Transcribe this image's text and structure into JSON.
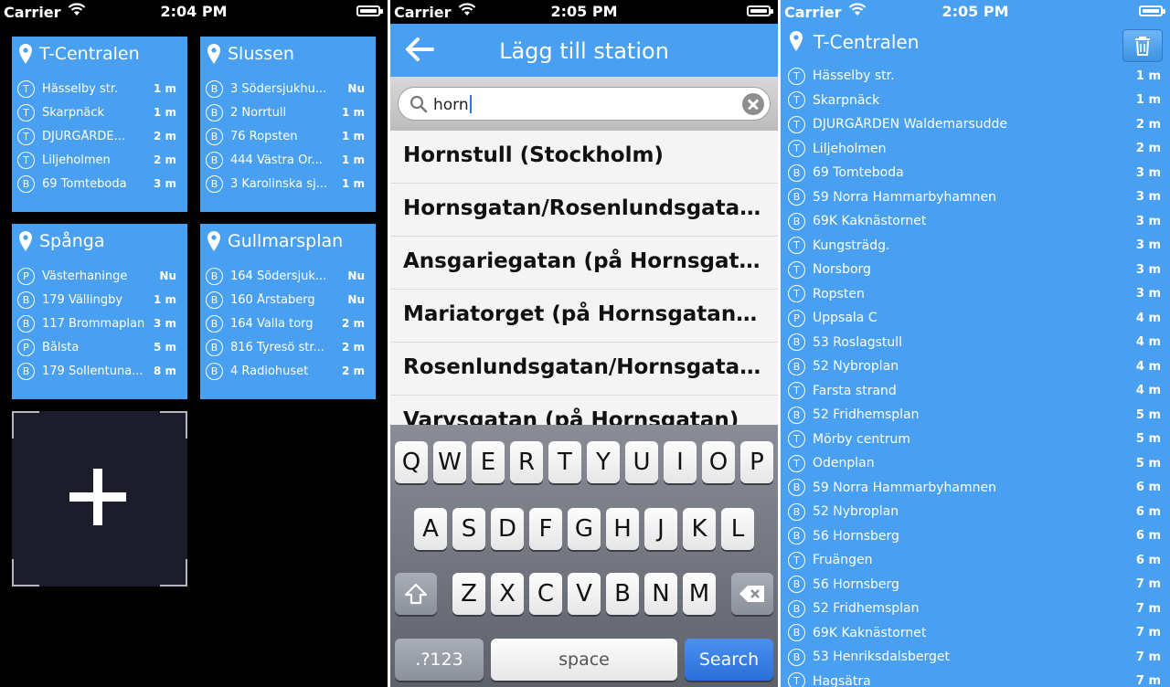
{
  "screens": [
    {
      "status": {
        "carrier": "Carrier",
        "time": "2:04 PM"
      },
      "tiles": [
        {
          "title": "T-Centralen",
          "rows": [
            {
              "badge": "T",
              "name": "Hässelby str.",
              "time": "1 m"
            },
            {
              "badge": "T",
              "name": "Skarpnäck",
              "time": "1 m"
            },
            {
              "badge": "T",
              "name": "DJURGÅRDE...",
              "time": "2 m"
            },
            {
              "badge": "T",
              "name": "Liljeholmen",
              "time": "2 m"
            },
            {
              "badge": "B",
              "name": "69 Tomteboda",
              "time": "3 m"
            }
          ]
        },
        {
          "title": "Slussen",
          "rows": [
            {
              "badge": "B",
              "name": "3 Södersjukhu...",
              "time": "Nu"
            },
            {
              "badge": "B",
              "name": "2 Norrtull",
              "time": "1 m"
            },
            {
              "badge": "B",
              "name": "76 Ropsten",
              "time": "1 m"
            },
            {
              "badge": "B",
              "name": "444 Västra Or...",
              "time": "1 m"
            },
            {
              "badge": "B",
              "name": "3 Karolinska sj...",
              "time": "1 m"
            }
          ]
        },
        {
          "title": "Spånga",
          "rows": [
            {
              "badge": "P",
              "name": "Västerhaninge",
              "time": "Nu"
            },
            {
              "badge": "B",
              "name": "179 Vällingby",
              "time": "1 m"
            },
            {
              "badge": "B",
              "name": "117 Brommaplan",
              "time": "3 m"
            },
            {
              "badge": "P",
              "name": "Bålsta",
              "time": "5 m"
            },
            {
              "badge": "B",
              "name": "179 Sollentuna...",
              "time": "8 m"
            }
          ]
        },
        {
          "title": "Gullmarsplan",
          "rows": [
            {
              "badge": "B",
              "name": "164 Södersjuk...",
              "time": "Nu"
            },
            {
              "badge": "B",
              "name": "160 Årstaberg",
              "time": "Nu"
            },
            {
              "badge": "B",
              "name": "164 Valla torg",
              "time": "2 m"
            },
            {
              "badge": "B",
              "name": "816 Tyresö str...",
              "time": "2 m"
            },
            {
              "badge": "B",
              "name": "4 Radiohuset",
              "time": "2 m"
            }
          ]
        }
      ]
    },
    {
      "status": {
        "carrier": "Carrier",
        "time": "2:05 PM"
      },
      "nav_title": "Lägg till station",
      "search_value": "horn",
      "results": [
        "Hornstull (Stockholm)",
        "Hornsgatan/Rosenlundsgatan...",
        "Ansgariegatan (på Hornsgata...",
        "Mariatorget (på Hornsgatan)...",
        "Rosenlundsgatan/Hornsgatan...",
        "Varvsgatan (på Hornsgatan)"
      ],
      "keyboard": {
        "row1": [
          "Q",
          "W",
          "E",
          "R",
          "T",
          "Y",
          "U",
          "I",
          "O",
          "P"
        ],
        "row2": [
          "A",
          "S",
          "D",
          "F",
          "G",
          "H",
          "J",
          "K",
          "L"
        ],
        "row3": [
          "Z",
          "X",
          "C",
          "V",
          "B",
          "N",
          "M"
        ],
        "num_label": ".?123",
        "space_label": "space",
        "search_label": "Search"
      }
    },
    {
      "status": {
        "carrier": "Carrier",
        "time": "2:05 PM"
      },
      "title": "T-Centralen",
      "departures": [
        {
          "badge": "T",
          "name": "Hässelby str.",
          "time": "1 m"
        },
        {
          "badge": "T",
          "name": "Skarpnäck",
          "time": "1 m"
        },
        {
          "badge": "T",
          "name": "DJURGÅRDEN Waldemarsudde",
          "time": "2 m"
        },
        {
          "badge": "T",
          "name": "Liljeholmen",
          "time": "2 m"
        },
        {
          "badge": "B",
          "name": "69 Tomteboda",
          "time": "3 m"
        },
        {
          "badge": "B",
          "name": "59 Norra Hammarbyhamnen",
          "time": "3 m"
        },
        {
          "badge": "B",
          "name": "69K Kaknästornet",
          "time": "3 m"
        },
        {
          "badge": "T",
          "name": "Kungsträdg.",
          "time": "3 m"
        },
        {
          "badge": "T",
          "name": "Norsborg",
          "time": "3 m"
        },
        {
          "badge": "T",
          "name": "Ropsten",
          "time": "3 m"
        },
        {
          "badge": "P",
          "name": "Uppsala C",
          "time": "4 m"
        },
        {
          "badge": "B",
          "name": "53 Roslagstull",
          "time": "4 m"
        },
        {
          "badge": "B",
          "name": "52 Nybroplan",
          "time": "4 m"
        },
        {
          "badge": "T",
          "name": "Farsta strand",
          "time": "4 m"
        },
        {
          "badge": "B",
          "name": "52 Fridhemsplan",
          "time": "5 m"
        },
        {
          "badge": "T",
          "name": "Mörby centrum",
          "time": "5 m"
        },
        {
          "badge": "T",
          "name": "Odenplan",
          "time": "5 m"
        },
        {
          "badge": "B",
          "name": "59 Norra Hammarbyhamnen",
          "time": "6 m"
        },
        {
          "badge": "B",
          "name": "52 Nybroplan",
          "time": "6 m"
        },
        {
          "badge": "B",
          "name": "56 Hornsberg",
          "time": "6 m"
        },
        {
          "badge": "T",
          "name": "Fruängen",
          "time": "6 m"
        },
        {
          "badge": "B",
          "name": "56 Hornsberg",
          "time": "7 m"
        },
        {
          "badge": "B",
          "name": "52 Fridhemsplan",
          "time": "7 m"
        },
        {
          "badge": "B",
          "name": "69K Kaknästornet",
          "time": "7 m"
        },
        {
          "badge": "B",
          "name": "53 Henriksdalsberget",
          "time": "7 m"
        },
        {
          "badge": "T",
          "name": "Hagsätra",
          "time": "7 m"
        }
      ]
    }
  ]
}
